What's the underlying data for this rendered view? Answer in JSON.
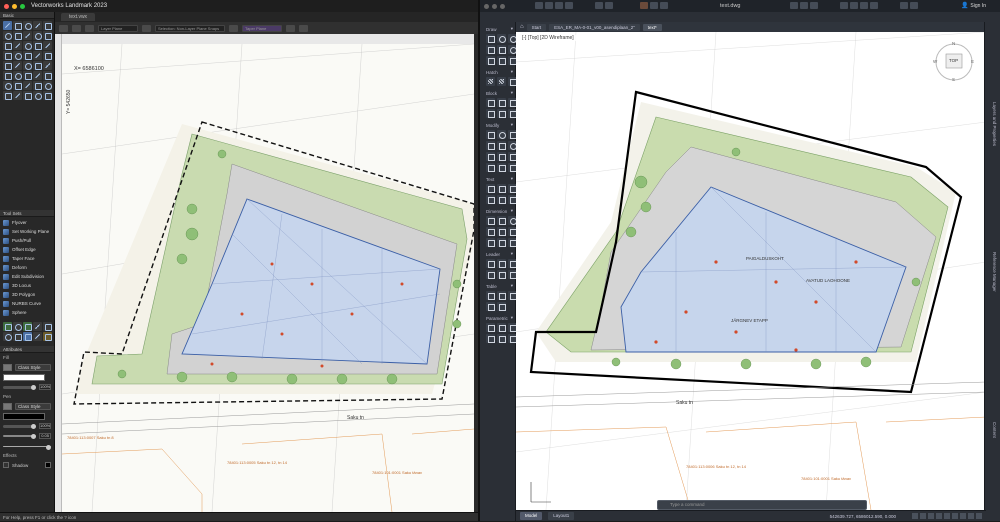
{
  "vectorworks": {
    "app_title": "Vectorworks Landmark 2023",
    "doc_tab": "text.vwx",
    "viewbar_field_1": "Layer Plane",
    "viewbar_field_2": "Taper Plane",
    "viewbar_field_3": "Selection: Non-Layer Plane Snaps",
    "basic_palette_title": "Basic",
    "tool_sets_title": "Tool Sets",
    "tools": [
      "Flyover",
      "Set Working Plane",
      "Push/Pull",
      "Offset Edge",
      "Taper Face",
      "Deform",
      "Edit Subdivision",
      "3D Locus",
      "3D Polygon",
      "NURBS Curve",
      "Sphere"
    ],
    "attributes_title": "Attributes",
    "fill_label": "Fill",
    "fill_style": "Class Style",
    "pen_label": "Pen",
    "pen_style": "Class Style",
    "opacity_1": "100%",
    "opacity_2": "100%",
    "line_weight": "0.05",
    "effects_label": "Effects",
    "shadow_label": "Shadow",
    "status": "For Help, press F1 or click the ? icon",
    "drawing_labels": {
      "coord_y": "X= 6586100",
      "coord_x": "Y= 542650",
      "label_bottom_1": "78401:113:0007\nSaku tn 8",
      "label_bottom_2": "78401:113:0005\nSaku tn 12, tn 14",
      "label_bottom_3": "78401:101:0001\nSaku tänav",
      "street": "Saku tn"
    }
  },
  "autocad": {
    "title": "text.dwg",
    "sign_in": "Sign In",
    "file_tabs": [
      "Start",
      "ESA_ER_MA-0-01_v00_asendiplaan_2\"",
      "text*"
    ],
    "view_label": "[-] [Top] [2D Wireframe]",
    "sections": [
      "Draw",
      "Hatch",
      "Block",
      "Modify",
      "Text",
      "Dimension",
      "Leader",
      "Table",
      "Parametric"
    ],
    "right_panels": [
      "Layers and Properties",
      "Reference Manager",
      "Content"
    ],
    "command_placeholder": "Type a command",
    "model_tab": "Model",
    "layout_tab": "Layout1",
    "coordinates": "542639.727, 6586012.590, 0.000",
    "viewcube": {
      "top": "TOP",
      "n": "N",
      "s": "S",
      "e": "E",
      "w": "W"
    },
    "drawing_labels": {
      "street": "Saku tn",
      "label_bottom_1": "78401:113:0006\nSaku tn 12, tn 14",
      "label_bottom_2": "78401:101:0001\nSaku tänav",
      "building_1": "PAIGALDUSKOHT",
      "building_2": "AVATUD LAOHOONE",
      "building_3": "JÄRGNEV ETAPP"
    }
  }
}
